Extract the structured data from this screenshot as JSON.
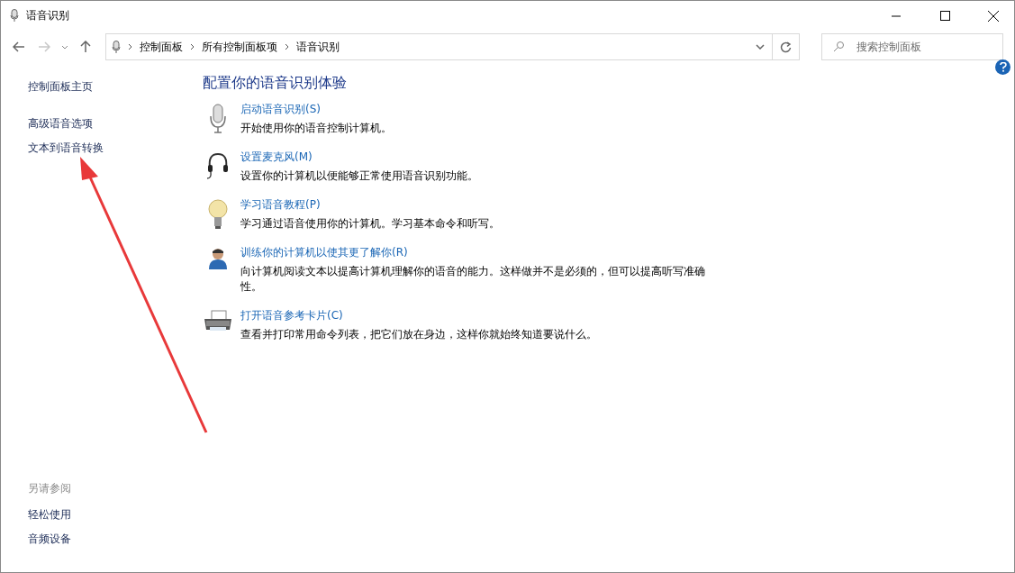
{
  "window": {
    "title": "语音识别"
  },
  "address_bar": {
    "breadcrumbs": [
      "控制面板",
      "所有控制面板项",
      "语音识别"
    ]
  },
  "search": {
    "placeholder": "搜索控制面板"
  },
  "sidebar": {
    "links": [
      "控制面板主页",
      "高级语音选项",
      "文本到语音转换"
    ],
    "see_also": {
      "heading": "另请参阅",
      "links": [
        "轻松使用",
        "音频设备"
      ]
    }
  },
  "main": {
    "heading": "配置你的语音识别体验",
    "tasks": [
      {
        "kind": "microphone",
        "title": "启动语音识别(S)",
        "description": "开始使用你的语音控制计算机。"
      },
      {
        "kind": "headset",
        "title": "设置麦克风(M)",
        "description": "设置你的计算机以便能够正常使用语音识别功能。"
      },
      {
        "kind": "bulb",
        "title": "学习语音教程(P)",
        "description": "学习通过语音使用你的计算机。学习基本命令和听写。"
      },
      {
        "kind": "person",
        "title": "训练你的计算机以使其更了解你(R)",
        "description": "向计算机阅读文本以提高计算机理解你的语音的能力。这样做并不是必须的，但可以提高听写准确性。"
      },
      {
        "kind": "printer",
        "title": "打开语音参考卡片(C)",
        "description": "查看并打印常用命令列表，把它们放在身边，这样你就始终知道要说什么。"
      }
    ]
  }
}
